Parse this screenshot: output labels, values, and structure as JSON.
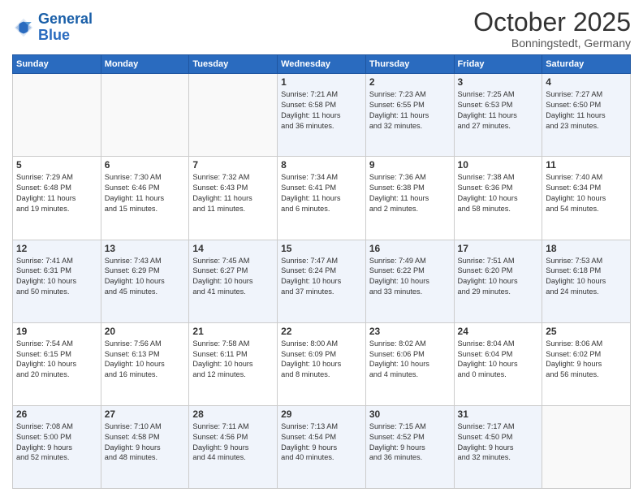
{
  "header": {
    "logo_line1": "General",
    "logo_line2": "Blue",
    "month": "October 2025",
    "location": "Bonningstedt, Germany"
  },
  "weekdays": [
    "Sunday",
    "Monday",
    "Tuesday",
    "Wednesday",
    "Thursday",
    "Friday",
    "Saturday"
  ],
  "weeks": [
    [
      {
        "num": "",
        "info": ""
      },
      {
        "num": "",
        "info": ""
      },
      {
        "num": "",
        "info": ""
      },
      {
        "num": "1",
        "info": "Sunrise: 7:21 AM\nSunset: 6:58 PM\nDaylight: 11 hours\nand 36 minutes."
      },
      {
        "num": "2",
        "info": "Sunrise: 7:23 AM\nSunset: 6:55 PM\nDaylight: 11 hours\nand 32 minutes."
      },
      {
        "num": "3",
        "info": "Sunrise: 7:25 AM\nSunset: 6:53 PM\nDaylight: 11 hours\nand 27 minutes."
      },
      {
        "num": "4",
        "info": "Sunrise: 7:27 AM\nSunset: 6:50 PM\nDaylight: 11 hours\nand 23 minutes."
      }
    ],
    [
      {
        "num": "5",
        "info": "Sunrise: 7:29 AM\nSunset: 6:48 PM\nDaylight: 11 hours\nand 19 minutes."
      },
      {
        "num": "6",
        "info": "Sunrise: 7:30 AM\nSunset: 6:46 PM\nDaylight: 11 hours\nand 15 minutes."
      },
      {
        "num": "7",
        "info": "Sunrise: 7:32 AM\nSunset: 6:43 PM\nDaylight: 11 hours\nand 11 minutes."
      },
      {
        "num": "8",
        "info": "Sunrise: 7:34 AM\nSunset: 6:41 PM\nDaylight: 11 hours\nand 6 minutes."
      },
      {
        "num": "9",
        "info": "Sunrise: 7:36 AM\nSunset: 6:38 PM\nDaylight: 11 hours\nand 2 minutes."
      },
      {
        "num": "10",
        "info": "Sunrise: 7:38 AM\nSunset: 6:36 PM\nDaylight: 10 hours\nand 58 minutes."
      },
      {
        "num": "11",
        "info": "Sunrise: 7:40 AM\nSunset: 6:34 PM\nDaylight: 10 hours\nand 54 minutes."
      }
    ],
    [
      {
        "num": "12",
        "info": "Sunrise: 7:41 AM\nSunset: 6:31 PM\nDaylight: 10 hours\nand 50 minutes."
      },
      {
        "num": "13",
        "info": "Sunrise: 7:43 AM\nSunset: 6:29 PM\nDaylight: 10 hours\nand 45 minutes."
      },
      {
        "num": "14",
        "info": "Sunrise: 7:45 AM\nSunset: 6:27 PM\nDaylight: 10 hours\nand 41 minutes."
      },
      {
        "num": "15",
        "info": "Sunrise: 7:47 AM\nSunset: 6:24 PM\nDaylight: 10 hours\nand 37 minutes."
      },
      {
        "num": "16",
        "info": "Sunrise: 7:49 AM\nSunset: 6:22 PM\nDaylight: 10 hours\nand 33 minutes."
      },
      {
        "num": "17",
        "info": "Sunrise: 7:51 AM\nSunset: 6:20 PM\nDaylight: 10 hours\nand 29 minutes."
      },
      {
        "num": "18",
        "info": "Sunrise: 7:53 AM\nSunset: 6:18 PM\nDaylight: 10 hours\nand 24 minutes."
      }
    ],
    [
      {
        "num": "19",
        "info": "Sunrise: 7:54 AM\nSunset: 6:15 PM\nDaylight: 10 hours\nand 20 minutes."
      },
      {
        "num": "20",
        "info": "Sunrise: 7:56 AM\nSunset: 6:13 PM\nDaylight: 10 hours\nand 16 minutes."
      },
      {
        "num": "21",
        "info": "Sunrise: 7:58 AM\nSunset: 6:11 PM\nDaylight: 10 hours\nand 12 minutes."
      },
      {
        "num": "22",
        "info": "Sunrise: 8:00 AM\nSunset: 6:09 PM\nDaylight: 10 hours\nand 8 minutes."
      },
      {
        "num": "23",
        "info": "Sunrise: 8:02 AM\nSunset: 6:06 PM\nDaylight: 10 hours\nand 4 minutes."
      },
      {
        "num": "24",
        "info": "Sunrise: 8:04 AM\nSunset: 6:04 PM\nDaylight: 10 hours\nand 0 minutes."
      },
      {
        "num": "25",
        "info": "Sunrise: 8:06 AM\nSunset: 6:02 PM\nDaylight: 9 hours\nand 56 minutes."
      }
    ],
    [
      {
        "num": "26",
        "info": "Sunrise: 7:08 AM\nSunset: 5:00 PM\nDaylight: 9 hours\nand 52 minutes."
      },
      {
        "num": "27",
        "info": "Sunrise: 7:10 AM\nSunset: 4:58 PM\nDaylight: 9 hours\nand 48 minutes."
      },
      {
        "num": "28",
        "info": "Sunrise: 7:11 AM\nSunset: 4:56 PM\nDaylight: 9 hours\nand 44 minutes."
      },
      {
        "num": "29",
        "info": "Sunrise: 7:13 AM\nSunset: 4:54 PM\nDaylight: 9 hours\nand 40 minutes."
      },
      {
        "num": "30",
        "info": "Sunrise: 7:15 AM\nSunset: 4:52 PM\nDaylight: 9 hours\nand 36 minutes."
      },
      {
        "num": "31",
        "info": "Sunrise: 7:17 AM\nSunset: 4:50 PM\nDaylight: 9 hours\nand 32 minutes."
      },
      {
        "num": "",
        "info": ""
      }
    ]
  ],
  "row_styles": [
    "shaded",
    "white",
    "shaded",
    "white",
    "shaded"
  ]
}
